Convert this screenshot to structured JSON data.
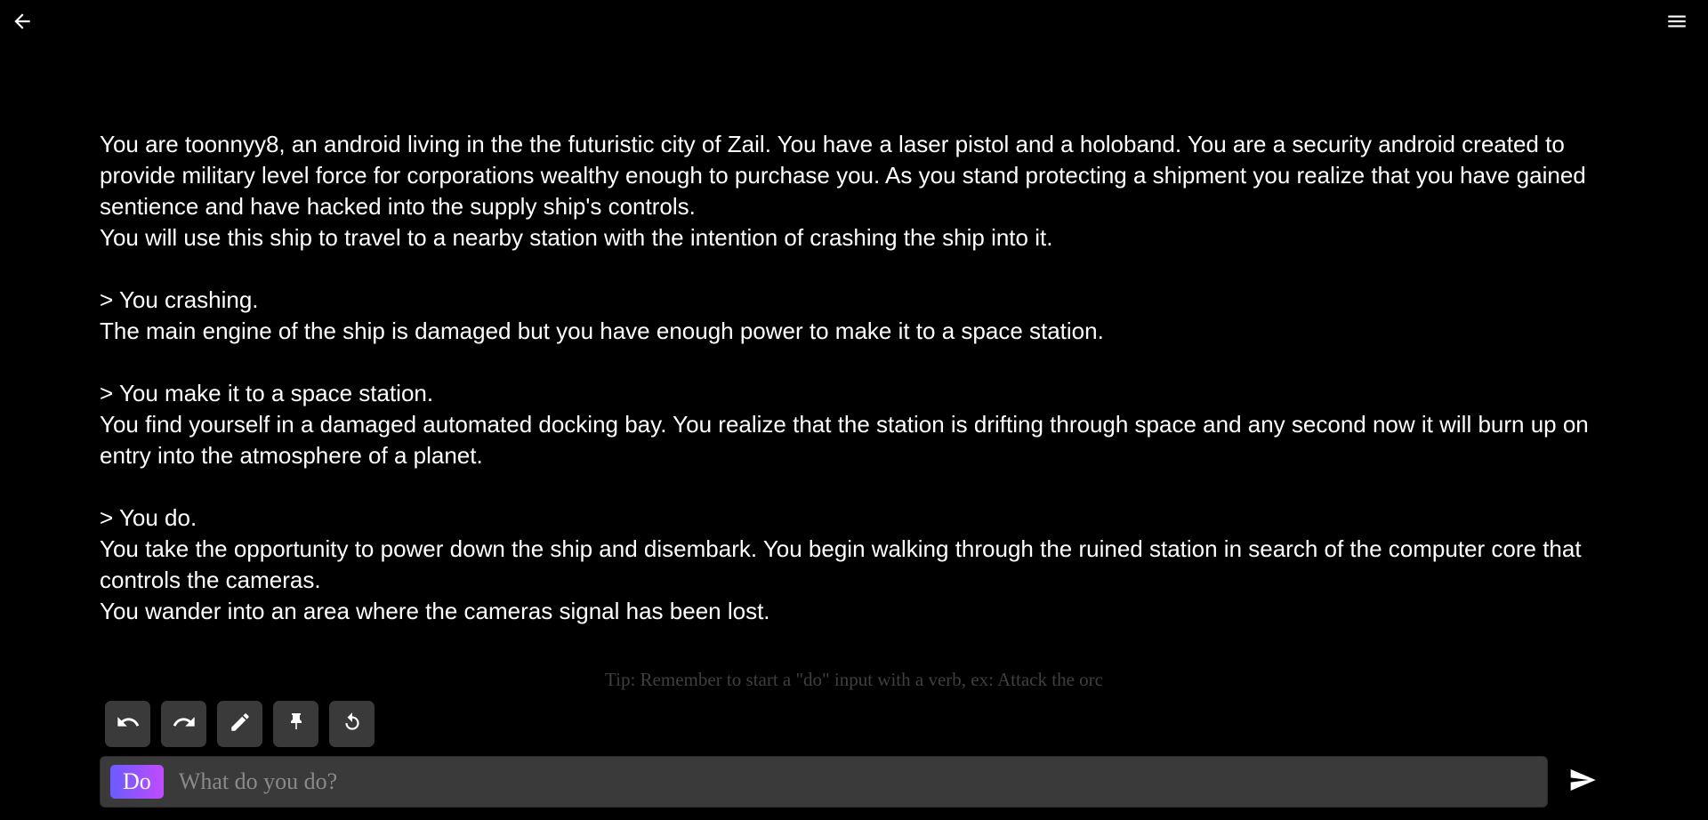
{
  "topbar": {
    "back_icon": "arrow-left-icon",
    "menu_icon": "hamburger-menu-icon"
  },
  "story": {
    "blocks": [
      {
        "action": "",
        "lines": [
          "You are toonnyy8, an android living in the the futuristic city of Zail. You have a laser pistol and a holoband. You are a security android created to provide military level force for corporations wealthy enough to purchase you. As you stand protecting a shipment you realize that you have gained sentience and have hacked into the supply ship's controls.",
          "You will use this ship to travel to a nearby station with the intention of crashing the ship into it."
        ]
      },
      {
        "action": "> You crashing.",
        "lines": [
          "The main engine of the ship is damaged but you have enough power to make it to a space station."
        ]
      },
      {
        "action": "> You make it to a space station.",
        "lines": [
          "You find yourself in a damaged automated docking bay. You realize that the station is drifting through space and any second now it will burn up on entry into the atmosphere of a planet."
        ]
      },
      {
        "action": "> You do.",
        "lines": [
          "You take the opportunity to power down the ship and disembark. You begin walking through the ruined station in search of the computer core that controls the cameras.",
          "You wander into an area where the cameras signal has been lost."
        ]
      }
    ]
  },
  "tip": "Tip: Remember to start a \"do\" input with a verb, ex: Attack the orc",
  "toolbar": {
    "buttons": [
      {
        "icon": "undo-icon"
      },
      {
        "icon": "redo-icon"
      },
      {
        "icon": "pencil-icon"
      },
      {
        "icon": "pin-icon"
      },
      {
        "icon": "retry-icon"
      }
    ]
  },
  "input": {
    "mode_label": "Do",
    "placeholder": "What do you do?",
    "value": "",
    "send_icon": "send-icon"
  },
  "colors": {
    "background": "#000000",
    "text": "#ffffff",
    "tip_text": "#3f3f3f",
    "button_bg": "#3a3a3a",
    "badge_gradient_start": "#6a5cff",
    "badge_gradient_end": "#c04bff"
  }
}
